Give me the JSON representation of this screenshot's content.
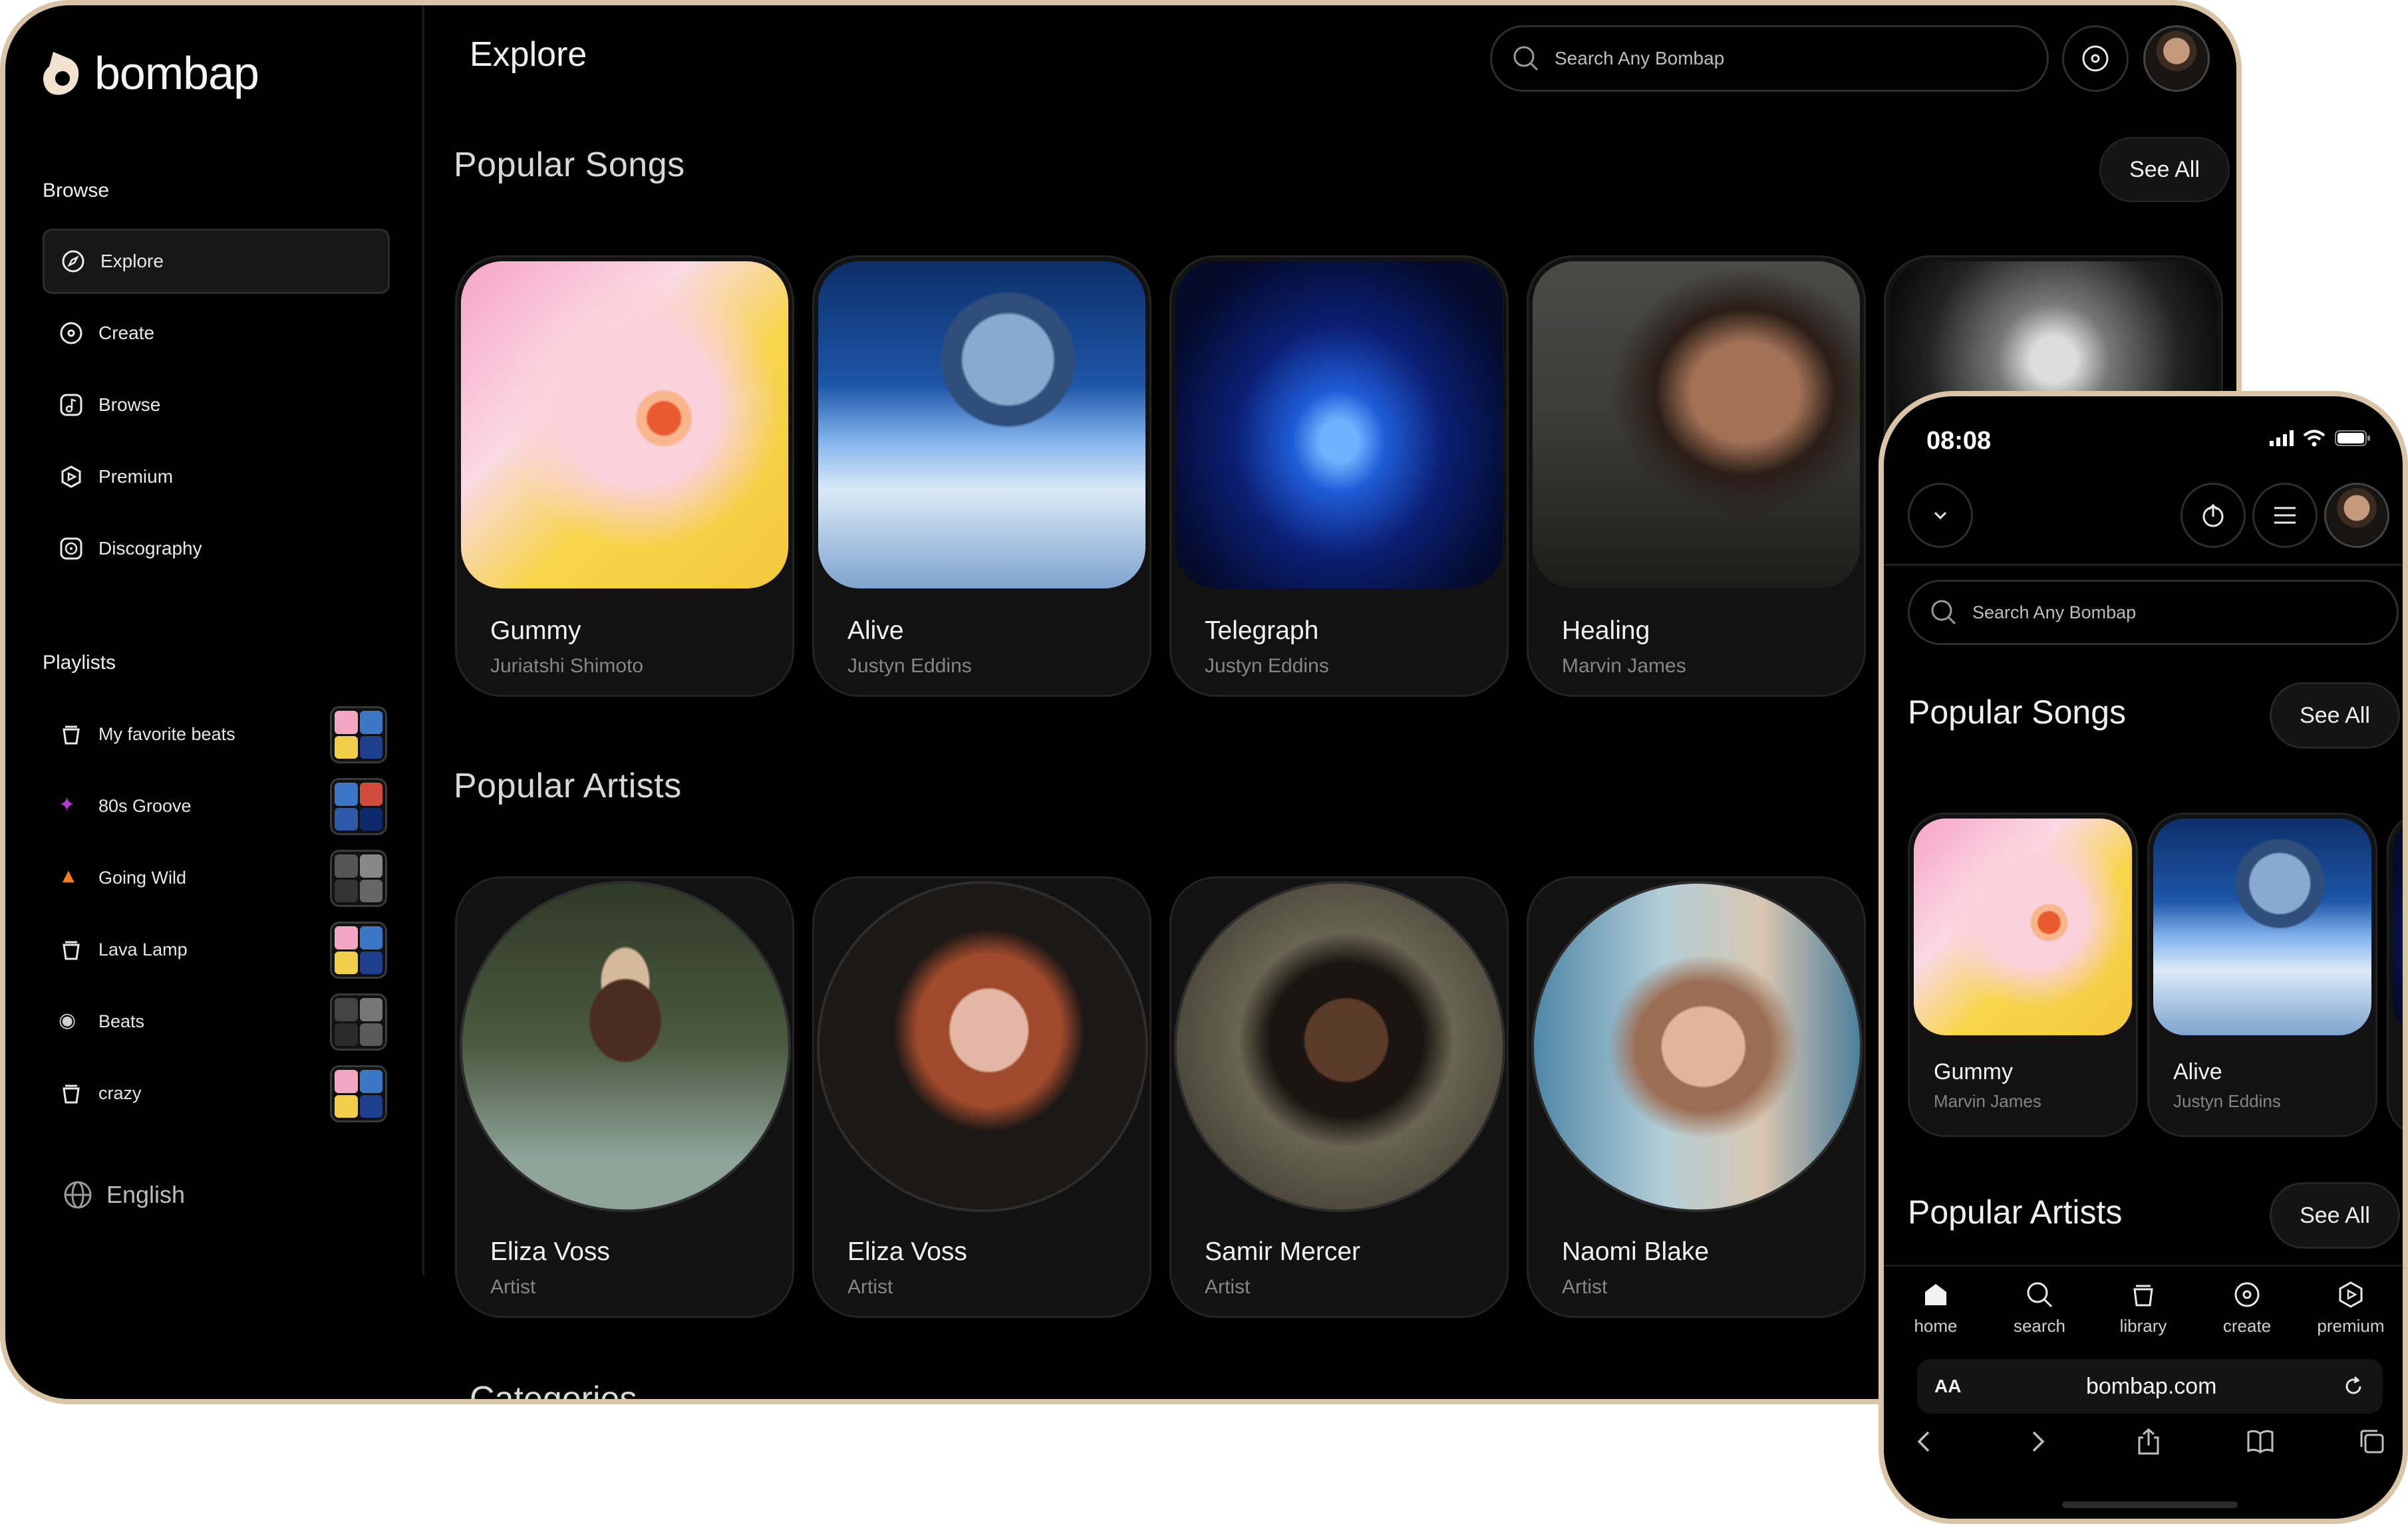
{
  "app": {
    "name": "bombap",
    "brand_color": "#f0e2cf",
    "frame_color": "#d9c4a6"
  },
  "sidebar": {
    "browse_heading": "Browse",
    "nav": [
      {
        "label": "Explore",
        "icon": "compass-icon",
        "active": true
      },
      {
        "label": "Create",
        "icon": "disc-icon",
        "active": false
      },
      {
        "label": "Browse",
        "icon": "music-note-icon",
        "active": false
      },
      {
        "label": "Premium",
        "icon": "premium-icon",
        "active": false
      },
      {
        "label": "Discography",
        "icon": "vinyl-icon",
        "active": false
      }
    ],
    "playlists_heading": "Playlists",
    "playlists": [
      {
        "label": "My favorite beats",
        "icon": "bucket-icon"
      },
      {
        "label": "80s Groove",
        "icon": "dancer-emoji"
      },
      {
        "label": "Going Wild",
        "icon": "fire-emoji"
      },
      {
        "label": "Lava Lamp",
        "icon": "bucket-icon"
      },
      {
        "label": "Beats",
        "icon": "cd-emoji"
      },
      {
        "label": "crazy",
        "icon": "bucket-icon"
      }
    ],
    "language": "English"
  },
  "header": {
    "title": "Explore",
    "search_placeholder": "Search Any Bombap"
  },
  "popular_songs": {
    "title": "Popular Songs",
    "see_all": "See All",
    "items": [
      {
        "title": "Gummy",
        "artist": "Juriatshi Shimoto"
      },
      {
        "title": "Alive",
        "artist": "Justyn Eddins"
      },
      {
        "title": "Telegraph",
        "artist": "Justyn Eddins"
      },
      {
        "title": "Healing",
        "artist": "Marvin James"
      }
    ]
  },
  "popular_artists": {
    "title": "Popular Artists",
    "items": [
      {
        "name": "Eliza Voss",
        "role": "Artist"
      },
      {
        "name": "Eliza Voss",
        "role": "Artist"
      },
      {
        "name": "Samir Mercer",
        "role": "Artist"
      },
      {
        "name": "Naomi Blake",
        "role": "Artist"
      }
    ]
  },
  "categories": {
    "title": "Categories"
  },
  "phone": {
    "time": "08:08",
    "search_placeholder": "Search Any Bombap",
    "popular_songs_title": "Popular Songs",
    "popular_artists_title": "Popular Artists",
    "see_all": "See All",
    "songs": [
      {
        "title": "Gummy",
        "artist": "Marvin James"
      },
      {
        "title": "Alive",
        "artist": "Justyn Eddins"
      }
    ],
    "tabs": [
      {
        "label": "home",
        "icon": "home-icon"
      },
      {
        "label": "search",
        "icon": "search-icon"
      },
      {
        "label": "library",
        "icon": "bucket-icon"
      },
      {
        "label": "create",
        "icon": "disc-icon"
      },
      {
        "label": "premium",
        "icon": "premium-icon"
      }
    ],
    "browser": {
      "aa": "AA",
      "url": "bombap.com"
    }
  }
}
